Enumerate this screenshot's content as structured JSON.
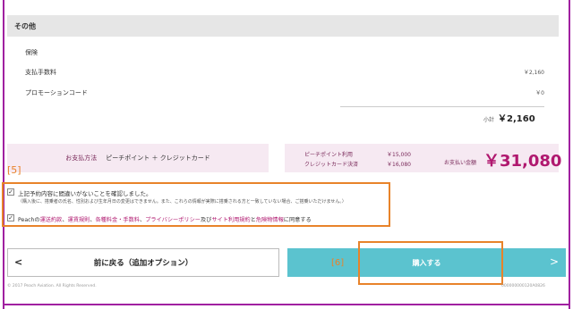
{
  "section": {
    "title": "その他"
  },
  "items": [
    {
      "label": "保険",
      "value": ""
    },
    {
      "label": "支払手数料",
      "value": "￥2,160"
    },
    {
      "label": "プロモーションコード",
      "value": "￥0"
    }
  ],
  "subtotal": {
    "label": "小計",
    "value": "￥2,160"
  },
  "payment": {
    "method_label": "お支払方法",
    "method_value": "ピーチポイント ＋ クレジットカード",
    "point_label": "ピーチポイント利用",
    "point_value": "￥15,000",
    "card_label": "クレジットカード決済",
    "card_value": "￥16,080",
    "total_label": "お支払い金額",
    "total_value": "￥31,080"
  },
  "annotations": {
    "step5": "[5]",
    "step6": "[6]"
  },
  "confirm": {
    "check1_text": "上記予約内容に間違いがないことを確認しました。",
    "check1_sub": "（購入後に、搭乗者の氏名、性別および生年月日の変更はできません。また、これらの情報が実際に搭乗される方と一致していない場合、ご搭乗いただけません。）",
    "check2_prefix": "Peachの",
    "check2_links": [
      "運送約款",
      "運賃規則",
      "各種料金・手数料",
      "プライバシーポリシー"
    ],
    "check2_and": "及び",
    "check2_link5": "サイト利用規約",
    "check2_and2": "と",
    "check2_link6": "危険物情報",
    "check2_suffix": "に同意する"
  },
  "buttons": {
    "back_label": "前に戻る（追加オプション）",
    "buy_label": "購入する"
  },
  "footer": {
    "copyright": "© 2017 Peach Aviation. All Rights Reserved.",
    "code": "000000000120A0826"
  }
}
